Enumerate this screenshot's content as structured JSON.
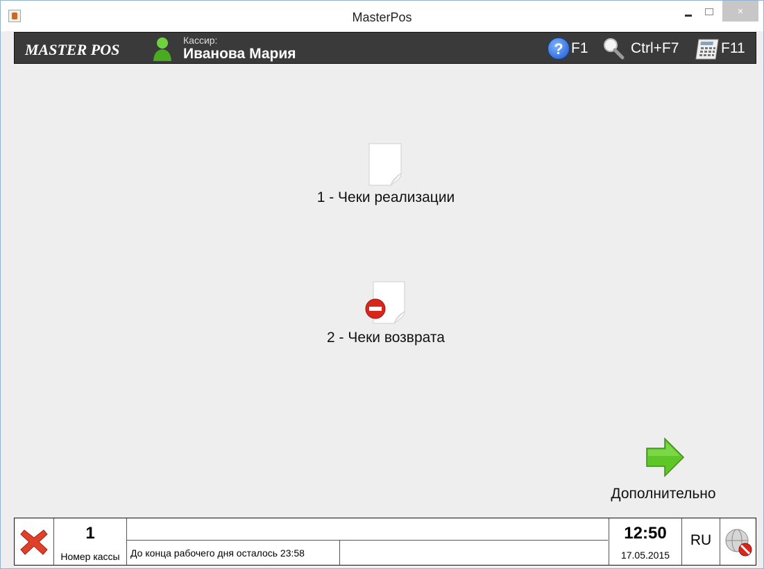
{
  "window": {
    "title": "MasterPos",
    "close_glyph": "×"
  },
  "header": {
    "logo": "MASTER POS",
    "cashier_caption": "Кассир:",
    "cashier_name": "Иванова Мария",
    "hotkeys": {
      "help": "F1",
      "search": "Ctrl+F7",
      "calculator": "F11"
    }
  },
  "main": {
    "items": [
      {
        "label": "1 - Чеки реализации",
        "icon": "document-icon"
      },
      {
        "label": "2 - Чеки возврата",
        "icon": "document-return-icon"
      }
    ],
    "more": {
      "label": "Дополнительно",
      "icon": "arrow-right-icon"
    }
  },
  "status": {
    "register_number": "1",
    "register_caption": "Номер кассы",
    "message": "",
    "shift_message": "До конца рабочего дня осталось 23:58",
    "time": "12:50",
    "date": "17.05.2015",
    "language": "RU"
  },
  "colors": {
    "header_bg": "#3a3a3a",
    "window_bg": "#eeeeee",
    "arrow_green": "#5ec626",
    "error_red": "#d9261c"
  }
}
